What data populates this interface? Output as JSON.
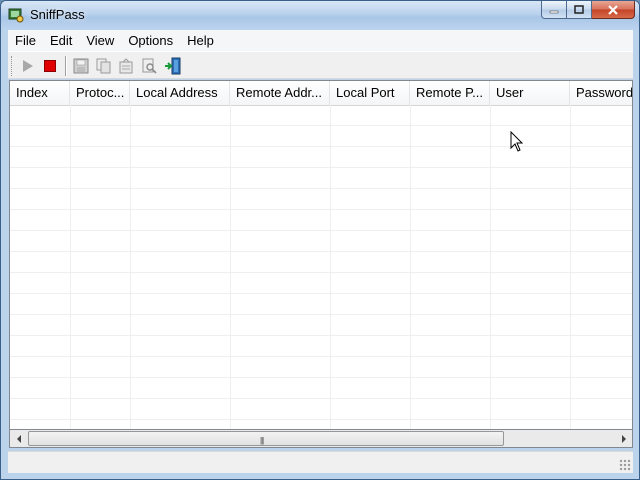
{
  "window": {
    "title": "SniffPass"
  },
  "menu": {
    "items": [
      "File",
      "Edit",
      "View",
      "Options",
      "Help"
    ]
  },
  "toolbar": {
    "buttons": [
      {
        "icon": "play-icon",
        "tooltip": "Start Capture",
        "enabled": false
      },
      {
        "icon": "stop-icon",
        "tooltip": "Stop Capture",
        "enabled": true
      },
      {
        "icon": "save-icon",
        "tooltip": "Save Selected Items",
        "enabled": false
      },
      {
        "icon": "copy-icon",
        "tooltip": "Copy Selected Items",
        "enabled": false
      },
      {
        "icon": "properties-icon",
        "tooltip": "Properties",
        "enabled": false
      },
      {
        "icon": "find-icon",
        "tooltip": "Find",
        "enabled": false
      },
      {
        "icon": "exit-icon",
        "tooltip": "Exit",
        "enabled": true
      }
    ]
  },
  "listview": {
    "columns": [
      "Index",
      "Protoc...",
      "Local Address",
      "Remote Addr...",
      "Local Port",
      "Remote P...",
      "User",
      "Password"
    ],
    "rows": []
  },
  "statusbar": {
    "text": ""
  },
  "colors": {
    "stop": "#e00000",
    "close_button": "#c24228",
    "titlebar": "#b9d1ec"
  }
}
